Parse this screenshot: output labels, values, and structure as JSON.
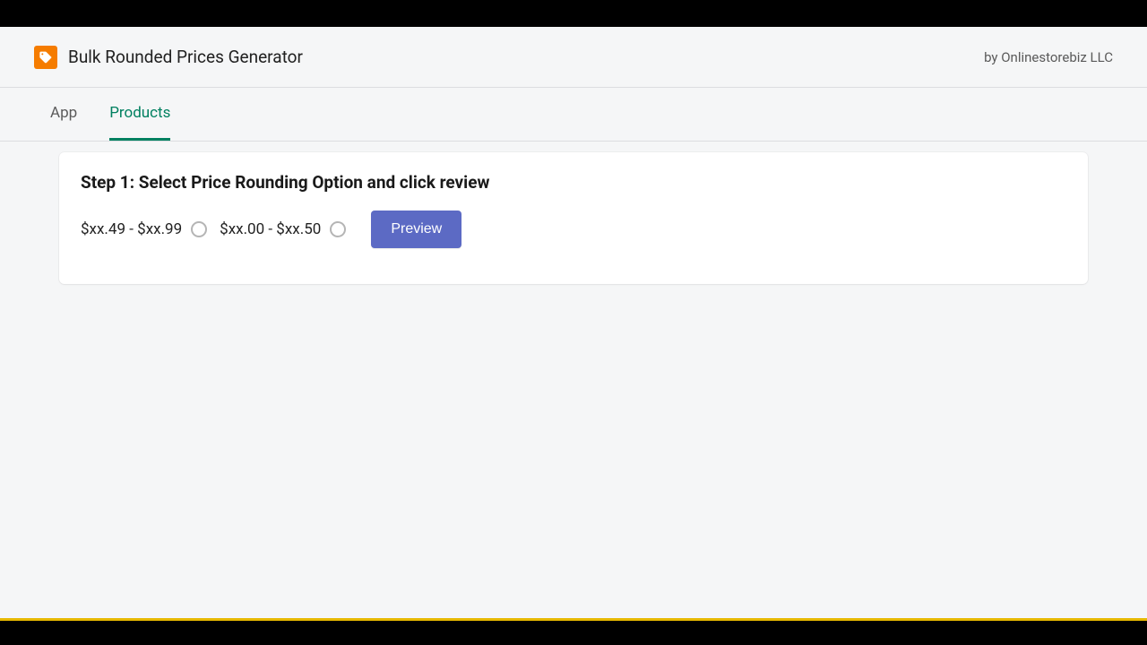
{
  "header": {
    "title": "Bulk Rounded Prices Generator",
    "byline": "by Onlinestorebiz LLC"
  },
  "tabs": [
    {
      "label": "App",
      "active": false
    },
    {
      "label": "Products",
      "active": true
    }
  ],
  "card": {
    "title": "Step 1: Select Price Rounding Option and click review",
    "options": [
      {
        "label": "$xx.49 - $xx.99"
      },
      {
        "label": "$xx.00 - $xx.50"
      }
    ],
    "preview_label": "Preview"
  }
}
